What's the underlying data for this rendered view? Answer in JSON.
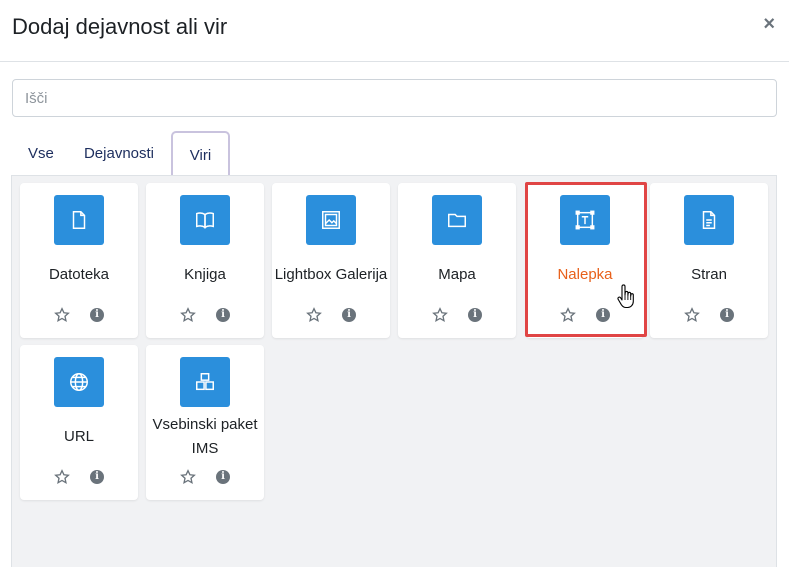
{
  "dialog": {
    "title": "Dodaj dejavnost ali vir",
    "close_label": "×"
  },
  "search": {
    "placeholder": "Išči",
    "value": ""
  },
  "tabs": [
    {
      "label": "Vse"
    },
    {
      "label": "Dejavnosti"
    },
    {
      "label": "Viri",
      "active": true
    }
  ],
  "accent_color": "#2b8fdc",
  "highlight_color": "#e8601a",
  "items": [
    {
      "label": "Datoteka",
      "icon": "file-icon"
    },
    {
      "label": "Knjiga",
      "icon": "book-icon"
    },
    {
      "label": "Lightbox Galerija",
      "icon": "image-gallery-icon"
    },
    {
      "label": "Mapa",
      "icon": "folder-icon"
    },
    {
      "label": "Nalepka",
      "icon": "text-label-icon",
      "highlighted": true
    },
    {
      "label": "Stran",
      "icon": "page-icon"
    },
    {
      "label": "URL",
      "icon": "globe-icon"
    },
    {
      "label": "Vsebinski paket IMS",
      "icon": "package-icon"
    }
  ],
  "info_glyph": "i"
}
